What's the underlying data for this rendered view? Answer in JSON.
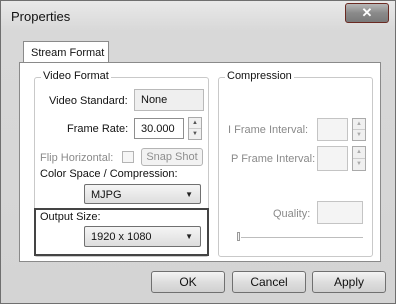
{
  "window": {
    "title": "Properties",
    "close_glyph": "✕"
  },
  "tabs": [
    {
      "label": "Stream Format",
      "active": true
    }
  ],
  "video_format": {
    "group_label": "Video Format",
    "standard_label": "Video Standard:",
    "standard_value": "None",
    "frame_rate_label": "Frame Rate:",
    "frame_rate_value": "30.000",
    "flip_label": "Flip Horizontal:",
    "flip_checked": false,
    "snapshot_label": "Snap Shot",
    "color_space_label": "Color Space / Compression:",
    "color_space_value": "MJPG",
    "output_size_label": "Output Size:",
    "output_size_value": "1920 x 1080"
  },
  "compression": {
    "group_label": "Compression",
    "i_frame_label": "I Frame Interval:",
    "i_frame_value": "",
    "p_frame_label": "P Frame Interval:",
    "p_frame_value": "",
    "quality_label": "Quality:",
    "quality_value": "",
    "quality_slider": 0
  },
  "buttons": {
    "ok": "OK",
    "cancel": "Cancel",
    "apply": "Apply"
  },
  "icons": {
    "close": "close-icon",
    "spin_up": "▲",
    "spin_down": "▼",
    "dropdown": "▼"
  }
}
